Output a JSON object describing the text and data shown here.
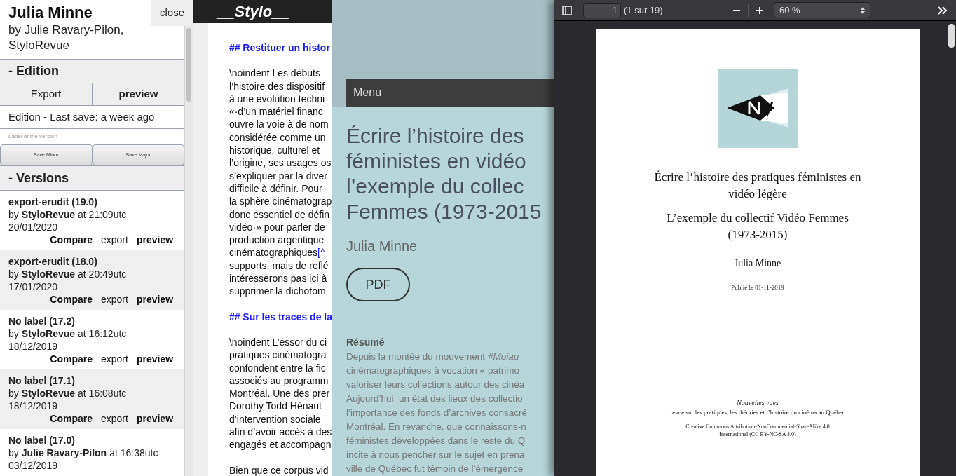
{
  "sidebar": {
    "title": "Julia Minne",
    "byline": "by Julie Ravary-Pilon, StyloRevue",
    "close": "close",
    "edition": {
      "heading": "- Edition",
      "buttons": [
        {
          "label": "Export",
          "kind": "normal"
        },
        {
          "label": "preview",
          "kind": "strong"
        }
      ],
      "status": "Edition - Last save: a week ago",
      "label_field": {
        "placeholder": "Label of the version"
      },
      "save_buttons": [
        "Save Minor",
        "Save Major"
      ]
    },
    "versions": {
      "heading": "- Versions",
      "items": [
        {
          "title": "export-erudit (19.0)",
          "by": "by",
          "author": "StyloRevue",
          "time": "at 21:09utc",
          "date": "20/01/2020",
          "actions": [
            {
              "label": "Compare",
              "kind": "strong"
            },
            {
              "label": "export",
              "kind": "normal"
            },
            {
              "label": "preview",
              "kind": "strong"
            }
          ]
        },
        {
          "title": "export-erudit (18.0)",
          "by": "by",
          "author": "StyloRevue",
          "time": "at 20:49utc",
          "date": "17/01/2020",
          "actions": [
            {
              "label": "Compare",
              "kind": "strong"
            },
            {
              "label": "export",
              "kind": "normal"
            },
            {
              "label": "preview",
              "kind": "strong"
            }
          ]
        },
        {
          "title": "No label (17.2)",
          "by": "by",
          "author": "StyloRevue",
          "time": "at 16:12utc",
          "date": "18/12/2019",
          "actions": [
            {
              "label": "Compare",
              "kind": "strong"
            },
            {
              "label": "export",
              "kind": "normal"
            },
            {
              "label": "preview",
              "kind": "strong"
            }
          ]
        },
        {
          "title": "No label (17.1)",
          "by": "by",
          "author": "StyloRevue",
          "time": "at 16:08utc",
          "date": "18/12/2019",
          "actions": [
            {
              "label": "Compare",
              "kind": "strong"
            },
            {
              "label": "export",
              "kind": "normal"
            },
            {
              "label": "preview",
              "kind": "strong"
            }
          ]
        },
        {
          "title": "No label (17.0)",
          "by": "by",
          "author": "Julie Ravary-Pilon",
          "time": "at 16:38utc",
          "date": "03/12/2019"
        }
      ]
    }
  },
  "editor": {
    "logo": "__Stylo__",
    "blocks": [
      {
        "kind": "heading",
        "lines": [
          {
            "text": "## Restituer un histor"
          }
        ]
      },
      {
        "kind": "paragraph",
        "lines": [
          {
            "text": "\\noindent Les débuts"
          },
          {
            "text": "l’histoire des dispositif"
          },
          {
            "text": "à une évolution techni"
          },
          {
            "text": "«·d’un matériel financ"
          },
          {
            "text": "ouvre la voie à de nom"
          },
          {
            "text": "considérée comme un"
          },
          {
            "text": "historique, culturel et"
          },
          {
            "text": "l’origine, ses usages os"
          },
          {
            "text": "s’expliquer par la diver"
          },
          {
            "text": "difficile à définir. Pour"
          },
          {
            "text": "la sphère cinématograp"
          },
          {
            "text": "donc essentiel de défin"
          },
          {
            "text": "vidéo·» pour parler de"
          },
          {
            "text": "production argentique"
          },
          {
            "text": "cinématographiques",
            "link": "[^"
          },
          {
            "text": "supports, mais de reflé"
          },
          {
            "text": "intéresserons pas ici à"
          },
          {
            "text": "supprimer la dichotom"
          }
        ]
      },
      {
        "kind": "heading",
        "lines": [
          {
            "text": "## Sur les traces de la"
          }
        ]
      },
      {
        "kind": "paragraph",
        "lines": [
          {
            "text": "\\noindent L’essor du ci"
          },
          {
            "text": "pratiques cinématogra"
          },
          {
            "text": "confondent entre la fic"
          },
          {
            "text": "associés au programm"
          },
          {
            "text": "Montréal. Une des prer"
          },
          {
            "text": "Dorothy Todd Hénaut"
          },
          {
            "text": "d’intervention sociale"
          },
          {
            "text": "afin d’avoir accès à des"
          },
          {
            "text": "engagés et accompagn"
          }
        ]
      },
      {
        "kind": "paragraph",
        "lines": [
          {
            "text": "Bien que ce corpus vid"
          }
        ]
      }
    ]
  },
  "preview": {
    "menu": "Menu",
    "title_lines": [
      "Écrire l’histoire des",
      "féministes en vidéo",
      "l’exemple du collec",
      "Femmes (1973-2015"
    ],
    "author": "Julia Minne",
    "pdf_button": "PDF",
    "abstract_heading": "Résumé",
    "abstract_lines": [
      "Depuis la montée du mouvement *#Moiau*",
      "cinématographiques à vocation « patrimo",
      "valoriser leurs collections autour des cinéa",
      "Aujourd’hui, un état des lieux des collectio",
      "l’importance des fonds d’archives consacré",
      "Montréal. En revanche, que connaissons-n",
      "féministes développées dans le reste du Q",
      "incite à nous pencher sur le sujet en prena",
      "ville de Québec fut témoin de l’émergence"
    ]
  },
  "pdf_viewer": {
    "page_number": "1",
    "page_count": "(1 sur 19)",
    "zoom": "60 %",
    "page": {
      "title": "Écrire l’histoire des pratiques féministes en vidéo légère",
      "subtitle": "L’exemple du collectif Vidéo Femmes (1973-2015)",
      "author": "Julia Minne",
      "published": "Publié le 01-11-2019",
      "journal": "Nouvelles vues",
      "journal_tagline": "revue sur les pratiques, les théories et l’histoire du cinéma au Québec",
      "license": "Creative Commons Attribution-NonCommercial-ShareAlike 4.0 International (CC BY-NC-SA 4.0)"
    }
  }
}
